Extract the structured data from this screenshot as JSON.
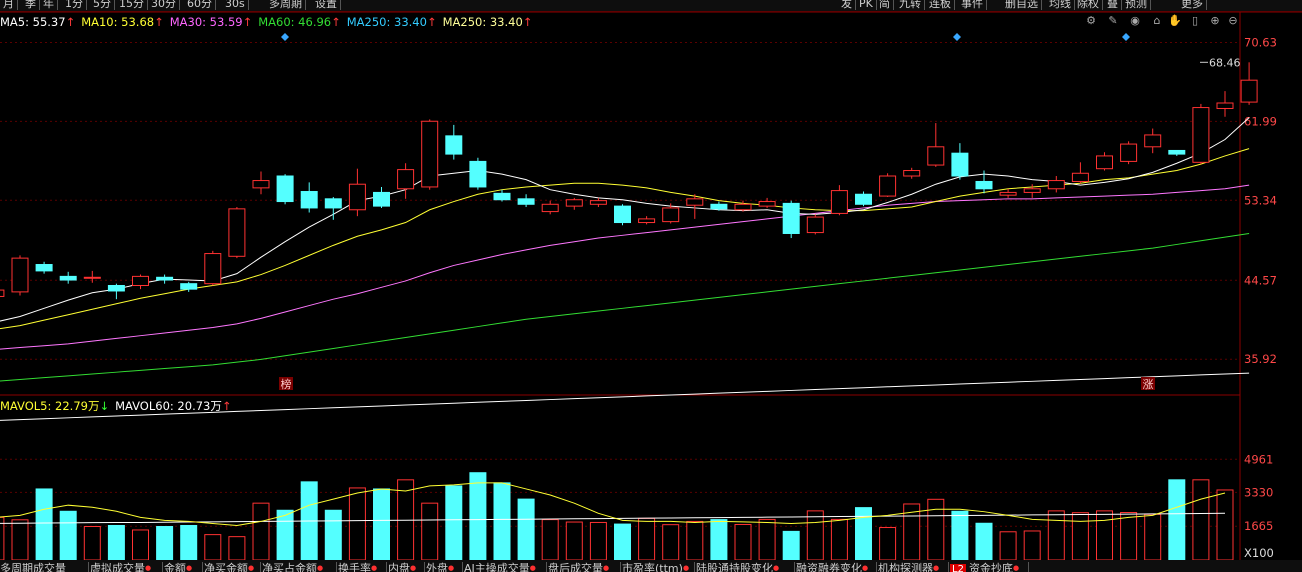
{
  "toolbar_left": [
    "月",
    "季",
    "年",
    "1分",
    "5分",
    "15分",
    "30分",
    "60分",
    "30s",
    "多周期",
    "设置"
  ],
  "toolbar_right": [
    "发",
    "PK",
    "简",
    "九转",
    "连板",
    "事件",
    "删自选",
    "均线",
    "除权",
    "叠",
    "预测",
    "更多"
  ],
  "ma_legend": [
    {
      "label": "MA5: 55.37",
      "arrow": "↑",
      "color": "#ffffff"
    },
    {
      "label": "MA10: 53.68",
      "arrow": "↑",
      "color": "#ffff33"
    },
    {
      "label": "MA30: 53.59",
      "arrow": "↑",
      "color": "#ff66ff"
    },
    {
      "label": "MA60: 46.96",
      "arrow": "↑",
      "color": "#33dd33"
    },
    {
      "label": "MA250: 33.40",
      "arrow": "↑",
      "color": "#33ccff"
    },
    {
      "label": "MA250: 33.40",
      "arrow": "↑",
      "color": "#ffff99"
    }
  ],
  "price_axis": [
    "70.63",
    "61.99",
    "53.34",
    "44.57",
    "35.92"
  ],
  "price_max_label": "68.46",
  "markers": [
    "榜",
    "涨"
  ],
  "vol_legend": [
    {
      "label": "MAVOL5: 22.79万",
      "arrow": "↓",
      "color": "#ffff33",
      "arrow_color": "#33ff33"
    },
    {
      "label": "MAVOL60: 20.73万",
      "arrow": "↑",
      "color": "#ffffff",
      "arrow_color": "#ff3b3b"
    }
  ],
  "vol_axis": [
    "4961",
    "3330",
    "1665",
    "X100"
  ],
  "bottom_tabs": [
    "多周期成交量",
    "虚拟成交量",
    "金额",
    "净买金额",
    "净买占金额",
    "换手率",
    "内盘",
    "外盘",
    "AI主操成交量",
    "盘后成交量",
    "市盈率(ttm)",
    "陆股通持股变化",
    "融资融券变化",
    "机构探测器",
    "资金抄底"
  ],
  "bottom_badge": "L2",
  "colors": {
    "up": "#ff3232",
    "down": "#54ffff",
    "grid": "#5a0000",
    "axis": "#ff4848"
  },
  "chart_data": {
    "type": "candlestick",
    "ylim": [
      32,
      72
    ],
    "candles": [
      [
        42.8,
        43.5,
        42.0,
        43.8
      ],
      [
        43.3,
        47.0,
        42.9,
        47.3
      ],
      [
        46.3,
        45.6,
        45.3,
        46.6
      ],
      [
        45.0,
        44.6,
        44.2,
        45.5
      ],
      [
        44.8,
        44.9,
        44.3,
        45.6
      ],
      [
        44.0,
        43.4,
        42.5,
        44.2
      ],
      [
        44.0,
        45.0,
        43.6,
        45.2
      ],
      [
        44.9,
        44.6,
        44.2,
        45.2
      ],
      [
        44.2,
        43.6,
        43.3,
        44.4
      ],
      [
        44.2,
        47.5,
        44.0,
        47.8
      ],
      [
        47.2,
        52.4,
        47.0,
        52.6
      ],
      [
        54.7,
        55.5,
        54.0,
        56.5
      ],
      [
        56.0,
        53.2,
        52.9,
        56.2
      ],
      [
        54.3,
        52.5,
        52.0,
        55.3
      ],
      [
        53.5,
        52.5,
        51.2,
        53.7
      ],
      [
        52.3,
        55.1,
        51.6,
        56.8
      ],
      [
        54.2,
        52.7,
        52.5,
        54.8
      ],
      [
        54.6,
        56.7,
        53.5,
        57.4
      ],
      [
        54.8,
        62.0,
        54.5,
        62.2
      ],
      [
        60.4,
        58.4,
        57.8,
        61.6
      ],
      [
        57.6,
        54.8,
        54.5,
        58.0
      ],
      [
        54.1,
        53.4,
        53.2,
        54.5
      ],
      [
        53.5,
        52.9,
        52.6,
        54.0
      ],
      [
        52.1,
        52.9,
        51.8,
        53.3
      ],
      [
        52.7,
        53.4,
        52.3,
        53.6
      ],
      [
        52.9,
        53.3,
        52.6,
        53.6
      ],
      [
        52.7,
        50.9,
        50.6,
        52.9
      ],
      [
        50.9,
        51.3,
        50.7,
        51.6
      ],
      [
        51.0,
        52.5,
        50.8,
        53.0
      ],
      [
        52.8,
        53.5,
        51.3,
        54.0
      ],
      [
        52.9,
        52.4,
        52.2,
        53.2
      ],
      [
        52.3,
        52.9,
        52.1,
        53.3
      ],
      [
        52.7,
        53.2,
        52.5,
        53.6
      ],
      [
        53.0,
        49.7,
        49.2,
        53.3
      ],
      [
        49.8,
        51.5,
        49.6,
        51.8
      ],
      [
        51.9,
        54.4,
        51.7,
        55.0
      ],
      [
        54.0,
        52.9,
        52.7,
        54.3
      ],
      [
        53.8,
        56.0,
        53.7,
        56.3
      ],
      [
        56.0,
        56.6,
        55.7,
        56.9
      ],
      [
        57.2,
        59.2,
        57.0,
        61.8
      ],
      [
        58.5,
        56.0,
        55.6,
        59.6
      ],
      [
        55.4,
        54.6,
        54.1,
        56.6
      ],
      [
        53.9,
        54.2,
        53.6,
        54.6
      ],
      [
        54.2,
        54.6,
        53.6,
        55.1
      ],
      [
        54.6,
        55.5,
        54.2,
        56.0
      ],
      [
        55.4,
        56.3,
        55.2,
        57.5
      ],
      [
        56.8,
        58.2,
        56.6,
        58.6
      ],
      [
        57.6,
        59.5,
        57.3,
        59.8
      ],
      [
        59.2,
        60.5,
        58.5,
        61.2
      ],
      [
        58.8,
        58.4,
        58.2,
        58.7
      ],
      [
        57.5,
        63.5,
        57.3,
        63.9
      ],
      [
        63.4,
        64.0,
        62.5,
        65.3
      ],
      [
        64.1,
        66.5,
        63.8,
        68.46
      ]
    ],
    "ma5": [
      40,
      40.6,
      41.5,
      42.4,
      43.2,
      43.6,
      44.2,
      44.7,
      44.6,
      44.5,
      45.3,
      47.1,
      48.8,
      50.4,
      51.8,
      53.3,
      53.8,
      54.5,
      56.0,
      56.3,
      56.6,
      56.2,
      55.6,
      54.5,
      54.0,
      53.6,
      53.4,
      53.0,
      52.7,
      52.5,
      52.3,
      52.2,
      52.3,
      51.9,
      51.8,
      52.0,
      52.3,
      53.1,
      54.0,
      55.1,
      55.9,
      56.2,
      56.0,
      55.6,
      55.4,
      55.0,
      55.3,
      55.7,
      56.4,
      57.4,
      58.5,
      60.0,
      62.4
    ],
    "ma10": [
      39.2,
      39.6,
      40.2,
      40.8,
      41.4,
      42.0,
      42.6,
      43.1,
      43.6,
      44.0,
      44.4,
      45.2,
      46.2,
      47.3,
      48.4,
      49.4,
      50.1,
      50.9,
      52.3,
      53.2,
      54.0,
      54.5,
      54.8,
      55.0,
      55.2,
      55.2,
      55.0,
      54.7,
      54.2,
      53.8,
      53.3,
      53.0,
      52.8,
      52.5,
      52.3,
      52.2,
      52.2,
      52.4,
      52.6,
      53.2,
      53.8,
      54.2,
      54.6,
      54.8,
      55.0,
      55.2,
      55.6,
      55.8,
      56.2,
      56.6,
      57.3,
      58.2,
      59.0
    ],
    "ma30": [
      37.0,
      37.2,
      37.4,
      37.6,
      37.9,
      38.2,
      38.5,
      38.8,
      39.1,
      39.4,
      39.8,
      40.4,
      41.1,
      41.8,
      42.5,
      43.1,
      43.8,
      44.5,
      45.4,
      46.2,
      46.8,
      47.4,
      47.9,
      48.4,
      48.8,
      49.2,
      49.5,
      49.8,
      50.1,
      50.4,
      50.7,
      51.0,
      51.3,
      51.6,
      51.9,
      52.2,
      52.5,
      52.8,
      53.0,
      53.2,
      53.3,
      53.4,
      53.5,
      53.5,
      53.6,
      53.7,
      53.8,
      53.9,
      54.0,
      54.2,
      54.4,
      54.6,
      55.0
    ],
    "ma60": [
      33.5,
      33.7,
      33.9,
      34.1,
      34.3,
      34.5,
      34.7,
      34.9,
      35.1,
      35.3,
      35.6,
      35.9,
      36.3,
      36.7,
      37.1,
      37.5,
      37.9,
      38.3,
      38.7,
      39.1,
      39.5,
      39.9,
      40.3,
      40.6,
      40.9,
      41.2,
      41.5,
      41.8,
      42.1,
      42.4,
      42.7,
      43.0,
      43.3,
      43.6,
      43.9,
      44.2,
      44.5,
      44.8,
      45.1,
      45.4,
      45.7,
      46.0,
      46.3,
      46.6,
      46.9,
      47.2,
      47.5,
      47.8,
      48.1,
      48.5,
      48.9,
      49.3,
      49.7
    ],
    "ma250": [
      29.2,
      29.3,
      29.4,
      29.5,
      29.6,
      29.7,
      29.8,
      29.9,
      30.0,
      30.1,
      30.2,
      30.3,
      30.4,
      30.5,
      30.6,
      30.7,
      30.8,
      30.9,
      31.0,
      31.1,
      31.2,
      31.3,
      31.4,
      31.5,
      31.6,
      31.7,
      31.8,
      31.9,
      32.0,
      32.1,
      32.2,
      32.3,
      32.4,
      32.5,
      32.6,
      32.7,
      32.8,
      32.9,
      33.0,
      33.1,
      33.2,
      33.3,
      33.4,
      33.5,
      33.6,
      33.7,
      33.8,
      33.9,
      34.0,
      34.1,
      34.2,
      34.3,
      34.4
    ],
    "volume": [
      2100,
      1980,
      3500,
      2400,
      1650,
      1700,
      1480,
      1650,
      1700,
      1250,
      1150,
      2800,
      2450,
      3850,
      2450,
      3550,
      3500,
      3950,
      2800,
      3650,
      4300,
      3800,
      3000,
      1990,
      1870,
      1850,
      1770,
      2050,
      1740,
      1900,
      1990,
      1750,
      2000,
      1410,
      2420,
      2000,
      2580,
      1600,
      2760,
      2990,
      2400,
      1810,
      1390,
      1430,
      2420,
      2330,
      2420,
      2340,
      2250,
      3950,
      3950,
      3450
    ],
    "mavol5": [
      2100,
      2200,
      2500,
      2700,
      2600,
      2400,
      2100,
      1950,
      1900,
      1800,
      1700,
      1900,
      2200,
      2700,
      3000,
      3300,
      3500,
      3400,
      3650,
      3700,
      3800,
      3800,
      3500,
      3200,
      2800,
      2300,
      1950,
      1900,
      1900,
      1850,
      1900,
      1880,
      1850,
      1800,
      1850,
      1950,
      2100,
      2200,
      2350,
      2500,
      2500,
      2380,
      2200,
      2000,
      1950,
      1900,
      1950,
      2100,
      2200,
      2600,
      3000,
      3300
    ],
    "mavol60": [
      1800,
      1810,
      1820,
      1830,
      1840,
      1850,
      1850,
      1860,
      1870,
      1880,
      1890,
      1900,
      1910,
      1920,
      1930,
      1940,
      1950,
      1960,
      1970,
      1980,
      1990,
      2000,
      2010,
      2020,
      2030,
      2040,
      2050,
      2060,
      2070,
      2080,
      2090,
      2100,
      2110,
      2120,
      2130,
      2140,
      2150,
      2160,
      2170,
      2180,
      2190,
      2200,
      2210,
      2220,
      2230,
      2240,
      2250,
      2260,
      2270,
      2280,
      2290,
      2300
    ],
    "vol_ylim": [
      0,
      5000
    ]
  }
}
